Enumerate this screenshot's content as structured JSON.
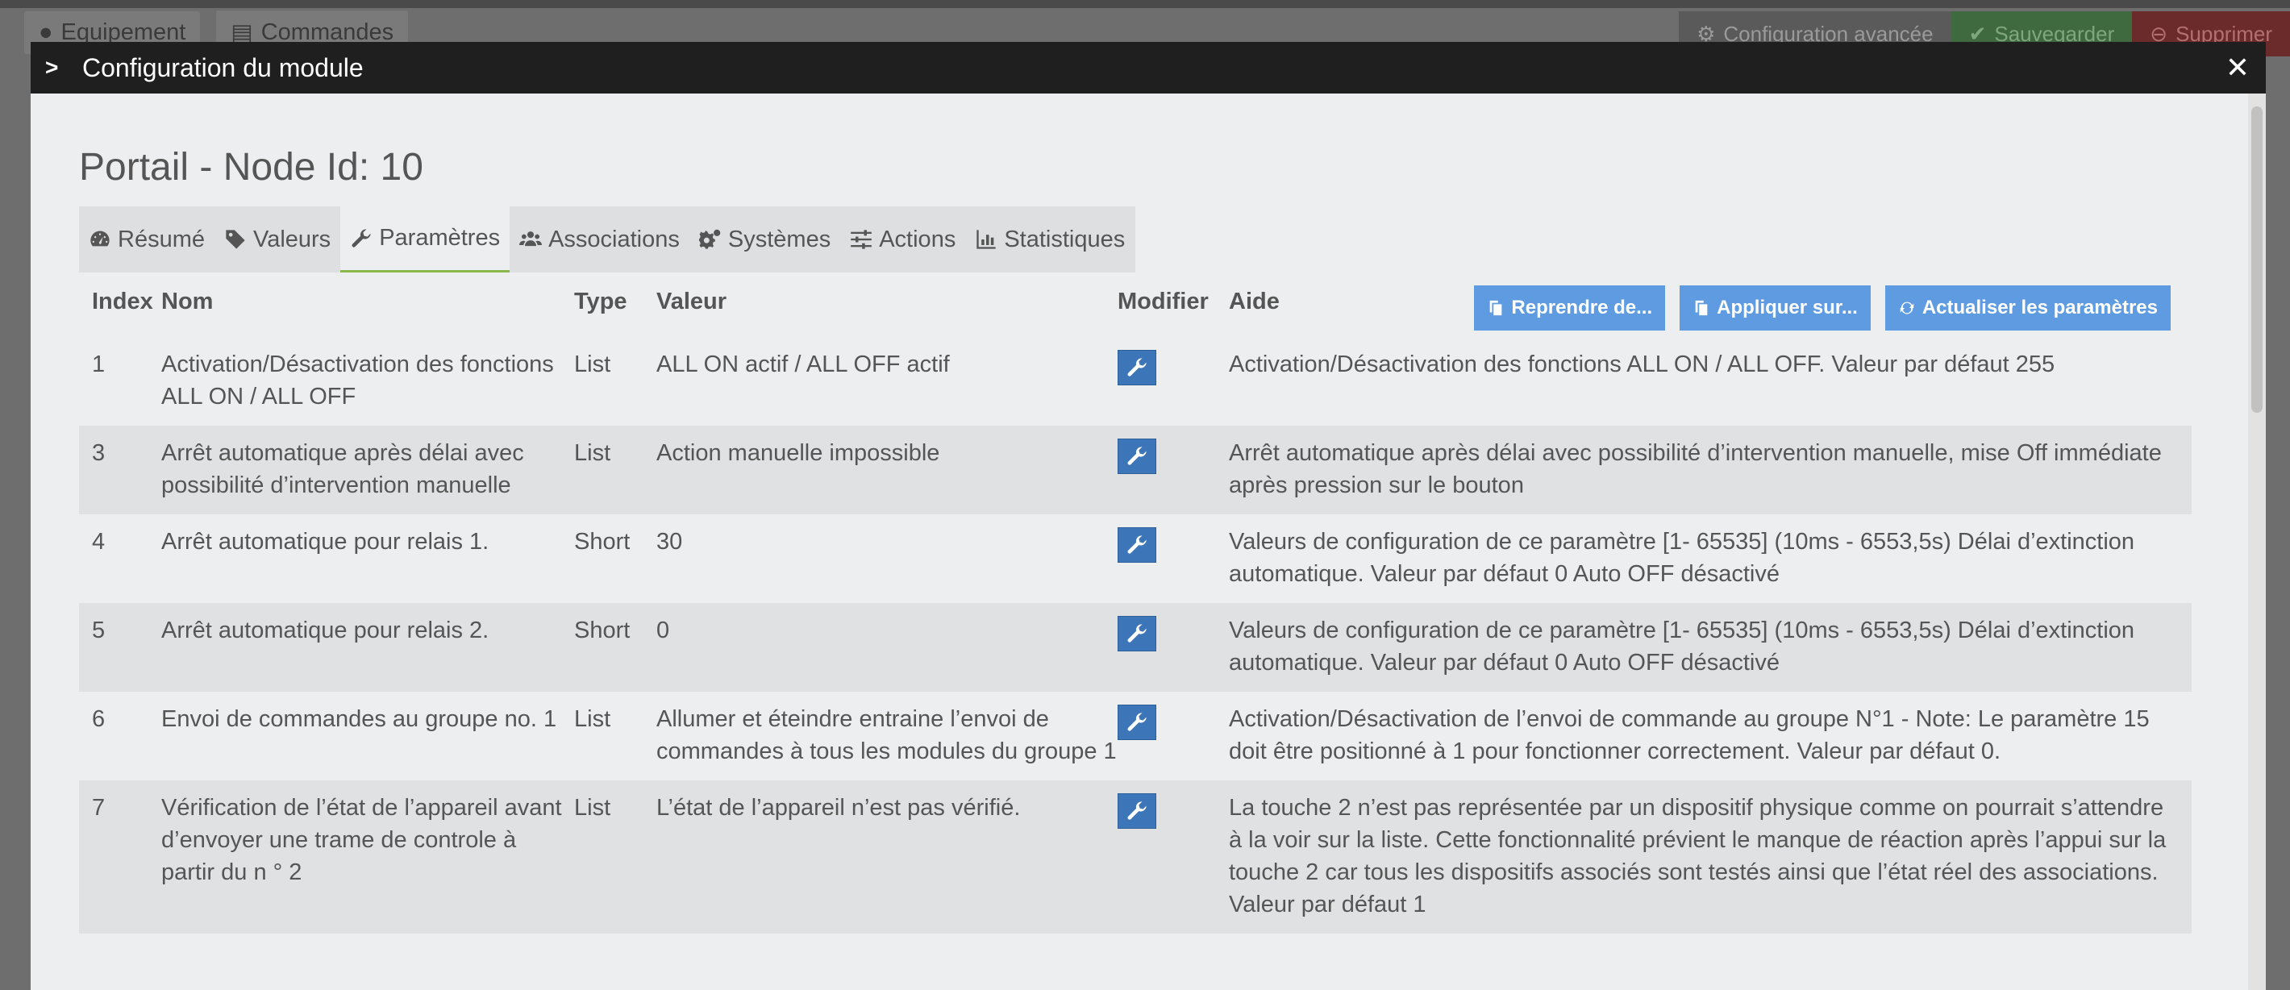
{
  "background": {
    "tabs": [
      {
        "label": "Equipement"
      },
      {
        "label": "Commandes"
      }
    ],
    "actions": {
      "advanced": "Configuration avancée",
      "save": "Sauvegarder",
      "delete": "Supprimer"
    }
  },
  "modal": {
    "title": "Configuration du module",
    "node_title": "Portail - Node Id: 10",
    "tabs": [
      {
        "label": "Résumé",
        "icon": "dashboard-icon"
      },
      {
        "label": "Valeurs",
        "icon": "tag-icon"
      },
      {
        "label": "Paramètres",
        "icon": "wrench-icon",
        "active": true
      },
      {
        "label": "Associations",
        "icon": "users-icon"
      },
      {
        "label": "Systèmes",
        "icon": "gears-icon"
      },
      {
        "label": "Actions",
        "icon": "sliders-icon"
      },
      {
        "label": "Statistiques",
        "icon": "bar-chart-icon"
      }
    ],
    "table": {
      "headers": {
        "index": "Index",
        "name": "Nom",
        "type": "Type",
        "value": "Valeur",
        "modify": "Modifier",
        "help": "Aide"
      },
      "buttons": {
        "reprendre": "Reprendre de...",
        "appliquer": "Appliquer sur...",
        "actualiser": "Actualiser les paramètres"
      },
      "rows": [
        {
          "index": "1",
          "name": "Activation/Désactivation des fonctions ALL ON / ALL OFF",
          "type": "List",
          "value": "ALL ON actif / ALL OFF actif",
          "help": "Activation/Désactivation des fonctions ALL ON / ALL OFF. Valeur par défaut 255"
        },
        {
          "index": "3",
          "name": "Arrêt automatique après délai avec possibilité d’intervention manuelle",
          "type": "List",
          "value": "Action manuelle impossible",
          "help": "Arrêt automatique après délai avec possibilité d’intervention manuelle, mise Off immédiate après pression sur le bouton"
        },
        {
          "index": "4",
          "name": "Arrêt automatique pour relais 1.",
          "type": "Short",
          "value": "30",
          "help": "Valeurs de configuration de ce paramètre [1- 65535] (10ms - 6553,5s) Délai d’extinction automatique. Valeur par défaut 0 Auto OFF désactivé"
        },
        {
          "index": "5",
          "name": "Arrêt automatique pour relais 2.",
          "type": "Short",
          "value": "0",
          "help": "Valeurs de configuration de ce paramètre [1- 65535] (10ms - 6553,5s) Délai d’extinction automatique. Valeur par défaut 0 Auto OFF désactivé"
        },
        {
          "index": "6",
          "name": "Envoi de commandes au groupe no. 1",
          "type": "List",
          "value": "Allumer et éteindre entraine l’envoi de commandes à tous les modules du groupe 1",
          "help": "Activation/Désactivation de l’envoi de commande au groupe N°1 - Note: Le paramètre 15 doit être positionné à 1 pour fonctionner correctement. Valeur par défaut 0."
        },
        {
          "index": "7",
          "name": "Vérification de l’état de l’appareil avant d’envoyer une trame de controle à partir du n ° 2",
          "type": "List",
          "value": "L’état de l’appareil n’est pas vérifié.",
          "help": "La touche 2 n’est pas représentée par un dispositif physique comme on pourrait s’attendre à la voir sur la liste. Cette fonctionnalité prévient le manque de réaction après l’appui sur la touche 2 car tous les dispositifs associés sont testés ainsi que l’état réel des associations. Valeur par défaut 1"
        }
      ]
    }
  }
}
